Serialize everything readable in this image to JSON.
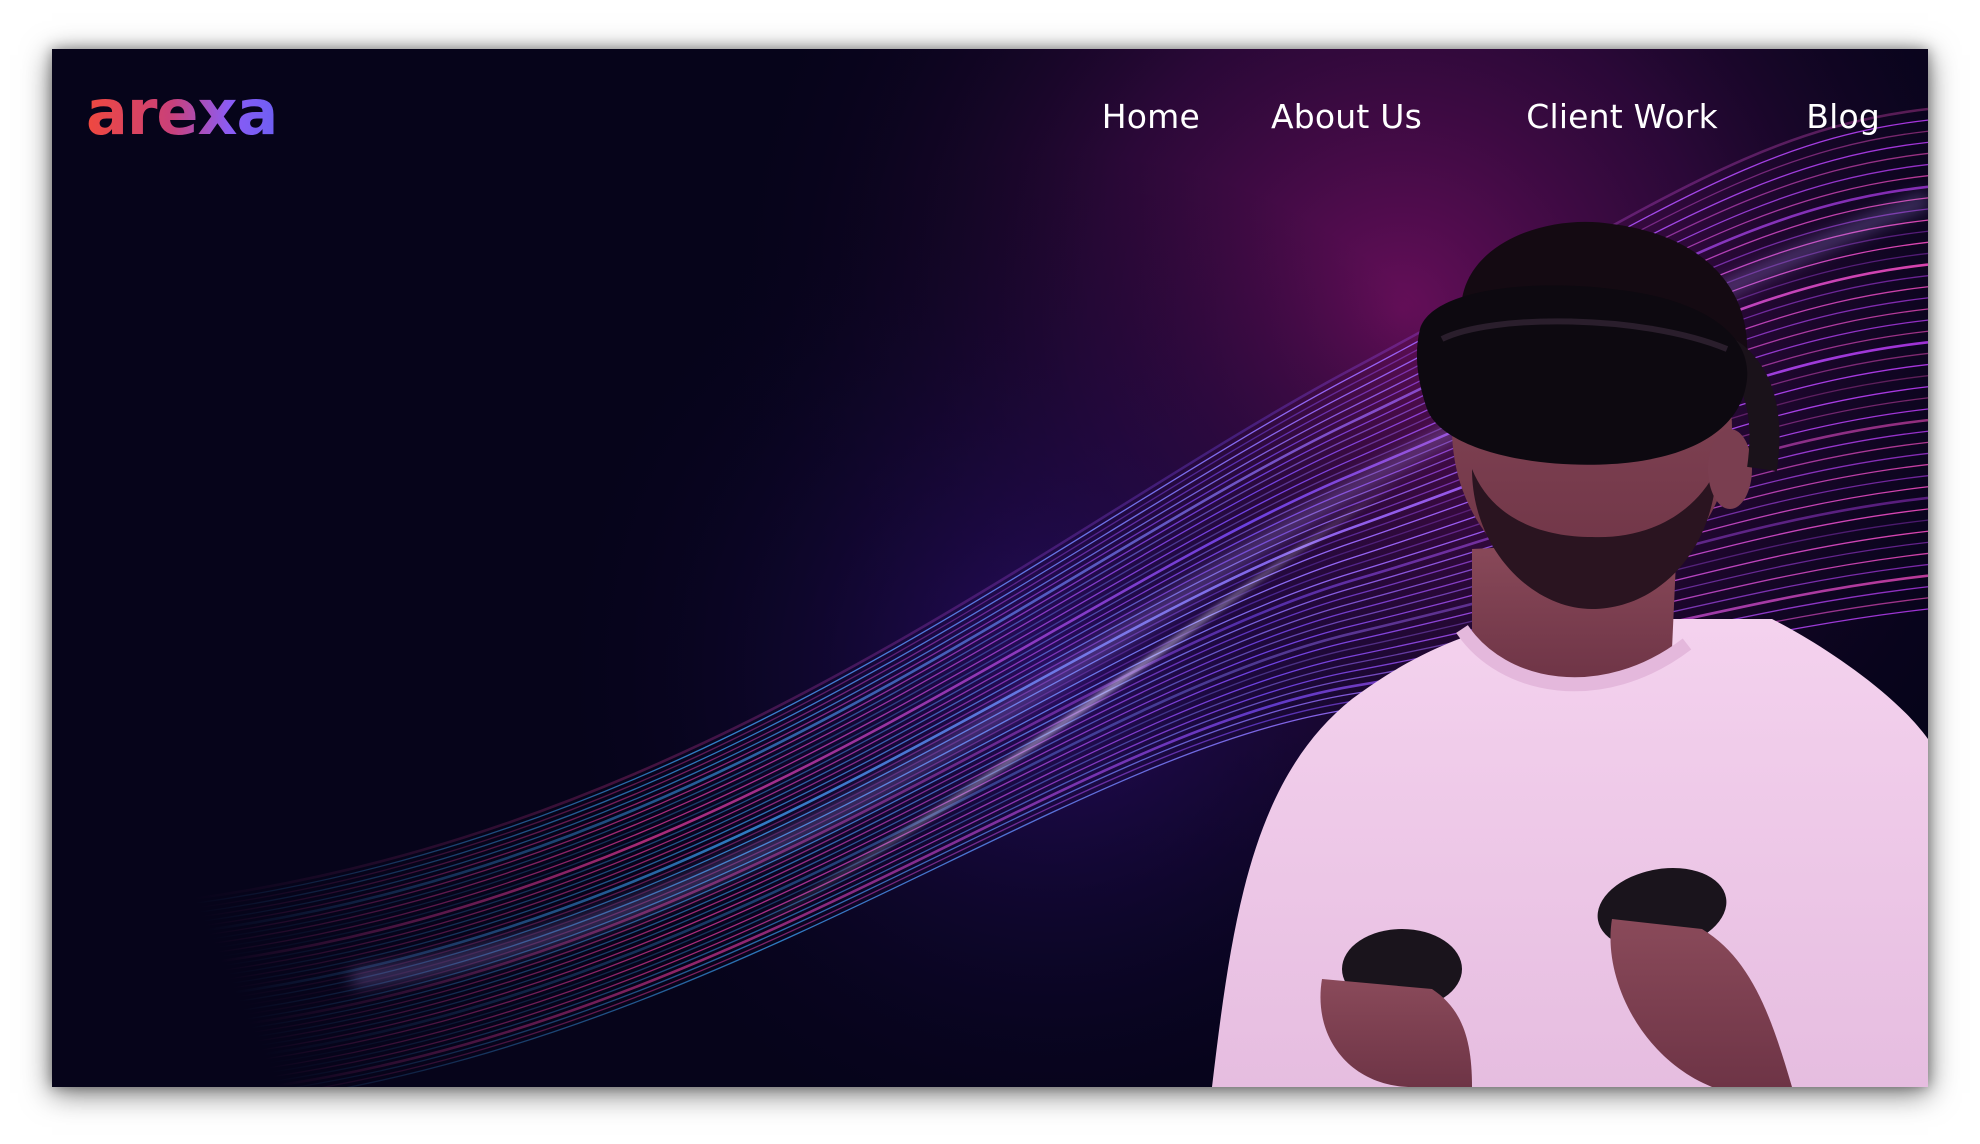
{
  "brand": {
    "logo_text": "arexa",
    "gradient": [
      "#f0483e",
      "#c9407a",
      "#8b5cf6",
      "#6d5ef2"
    ]
  },
  "nav": {
    "items": [
      {
        "label": "Home"
      },
      {
        "label": "About Us"
      },
      {
        "label": "Client Work"
      },
      {
        "label": "Blog"
      }
    ]
  },
  "hero": {
    "background_colors": [
      "#06041a",
      "#1a0736",
      "#4a0a4e"
    ],
    "streak_colors": [
      "#ff3fa8",
      "#7a4dff",
      "#3da8ff",
      "#c23cff"
    ],
    "person_icon": "vr-headset-person"
  }
}
